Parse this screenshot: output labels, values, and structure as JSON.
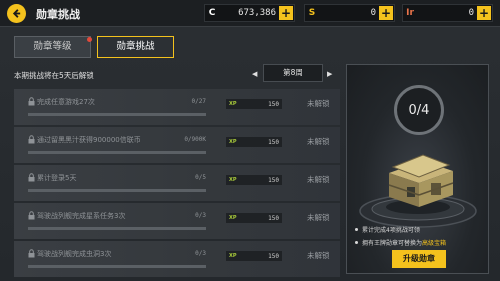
{
  "header": {
    "title": "勋章挑战",
    "currencies": [
      {
        "symbol": "C",
        "value": "673,386",
        "color": "#ffffff"
      },
      {
        "symbol": "S",
        "value": "0",
        "color": "#f4c21d"
      },
      {
        "symbol": "Ir",
        "value": "0",
        "color": "#e8734a"
      }
    ],
    "plus_label": "+"
  },
  "tabs": [
    {
      "label": "勋章等级",
      "active": false,
      "has_dot": true
    },
    {
      "label": "勋章挑战",
      "active": true,
      "has_dot": false
    }
  ],
  "unlock_hint": "本期挑战将在5天后解锁",
  "week": {
    "label": "第8周",
    "prev_arrow": "◀",
    "next_arrow": "▶"
  },
  "tasks": [
    {
      "name": "完成任意游戏27次",
      "progress": "0/27",
      "progress_fraction": 0,
      "xp_label": "XP",
      "xp": "150",
      "status": "未解锁"
    },
    {
      "name": "通过留黑黑汁获得900000信联币",
      "progress": "0/900K",
      "progress_fraction": 0,
      "xp_label": "XP",
      "xp": "150",
      "status": "未解锁"
    },
    {
      "name": "累计登录5天",
      "progress": "0/5",
      "progress_fraction": 0,
      "xp_label": "XP",
      "xp": "150",
      "status": "未解锁"
    },
    {
      "name": "驾驶战列舰完成星系任务3次",
      "progress": "0/3",
      "progress_fraction": 0,
      "xp_label": "XP",
      "xp": "150",
      "status": "未解锁"
    },
    {
      "name": "驾驶战列舰完成虫洞3次",
      "progress": "0/3",
      "progress_fraction": 0,
      "xp_label": "XP",
      "xp": "150",
      "status": "未解锁"
    }
  ],
  "reward_panel": {
    "counter": "0/4",
    "line1": "累计完成4项挑战可领",
    "line2_prefix": "拥有王牌勋章可替换为",
    "line2_highlight": "高级宝箱",
    "upgrade_label": "升级勋章"
  },
  "colors": {
    "accent": "#f4c21d",
    "xp_green": "#a7c93a",
    "dot_red": "#e24a3b"
  }
}
